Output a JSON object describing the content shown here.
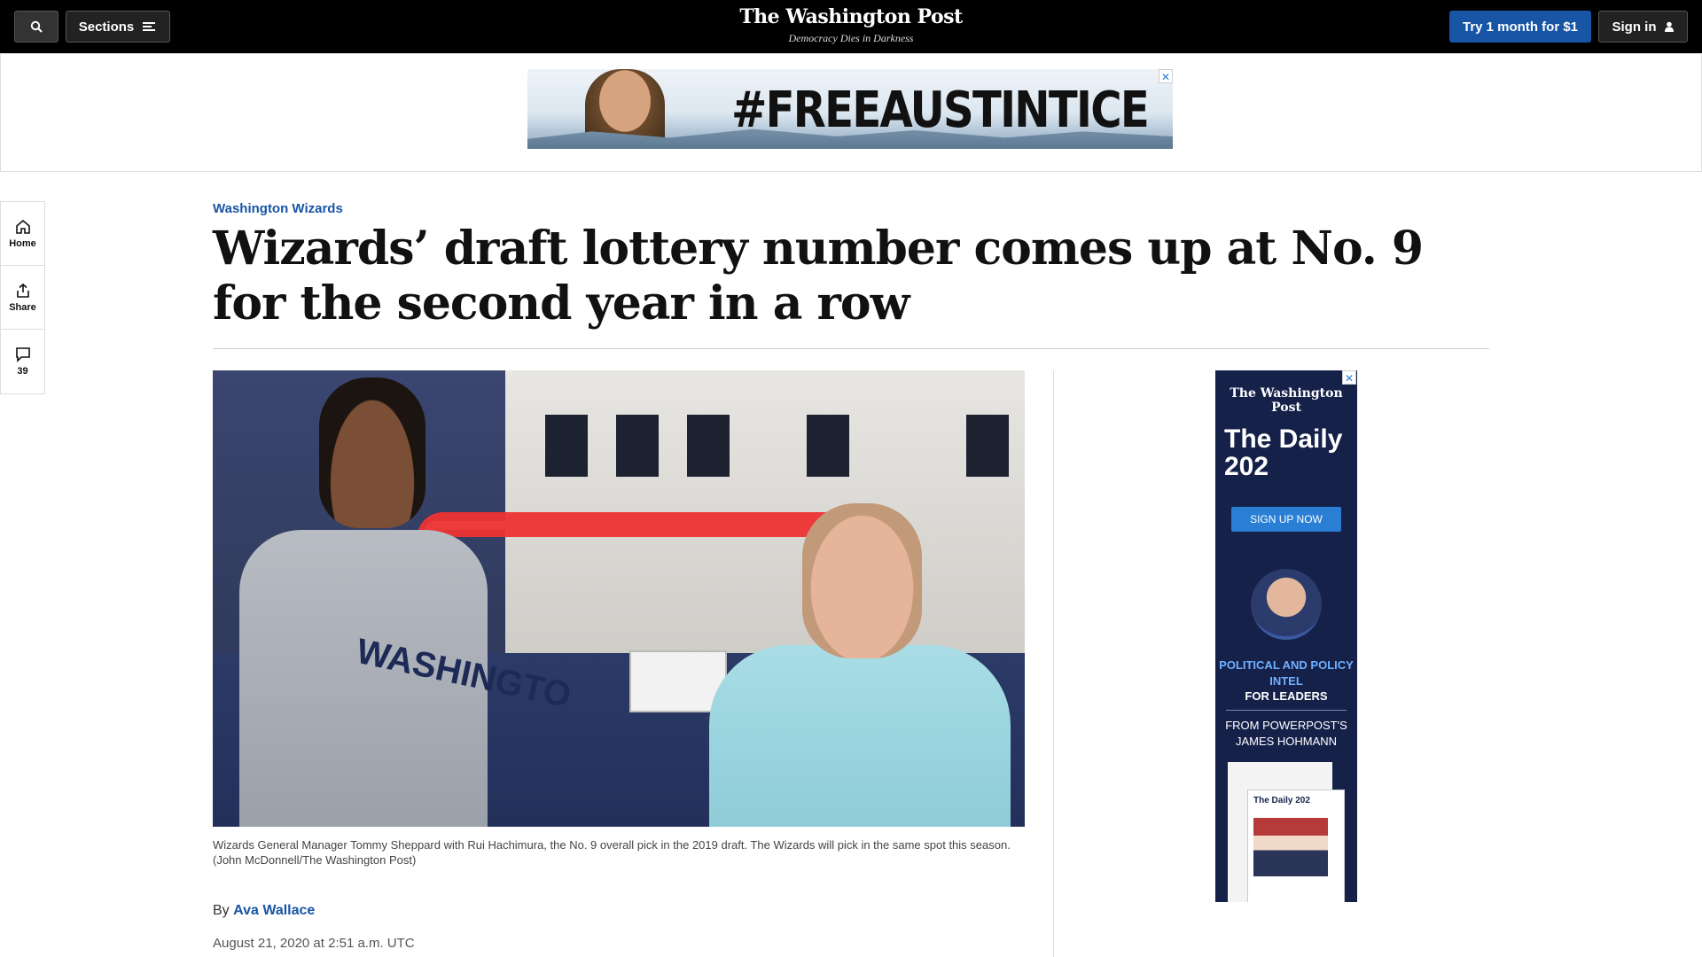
{
  "nav": {
    "sections_label": "Sections",
    "masthead": "The Washington Post",
    "tagline": "Democracy Dies in Darkness",
    "try_label": "Try 1 month for $1",
    "signin_label": "Sign in"
  },
  "top_ad": {
    "text": "#FREEAUSTINTICE",
    "close": "✕"
  },
  "rail": {
    "home": "Home",
    "share": "Share",
    "comments_count": "39"
  },
  "article": {
    "kicker": "Washington Wizards",
    "headline": "Wizards’ draft lottery number comes up at No. 9 for the second year in a row",
    "photo_jersey_text": "WASHINGTO",
    "caption": "Wizards General Manager Tommy Sheppard with Rui Hachimura, the No. 9 overall pick in the 2019 draft. The Wizards will pick in the same spot this season. (John McDonnell/The Washington Post)",
    "byline_prefix": "By",
    "author": "Ava Wallace",
    "date": "August 21, 2020 at 2:51 a.m. UTC"
  },
  "side_ad": {
    "logo": "The Washington Post",
    "title": "The Daily 202",
    "cta": "SIGN UP NOW",
    "line1": "POLITICAL AND POLICY INTEL",
    "line2": "FOR LEADERS",
    "line3": "FROM POWERPOST'S JAMES HOHMANN",
    "paper_title": "The Daily 202",
    "close": "✕"
  },
  "colors": {
    "accent_blue": "#1955a5",
    "topbar": "#000000",
    "side_ad_bg": "#16214a"
  }
}
